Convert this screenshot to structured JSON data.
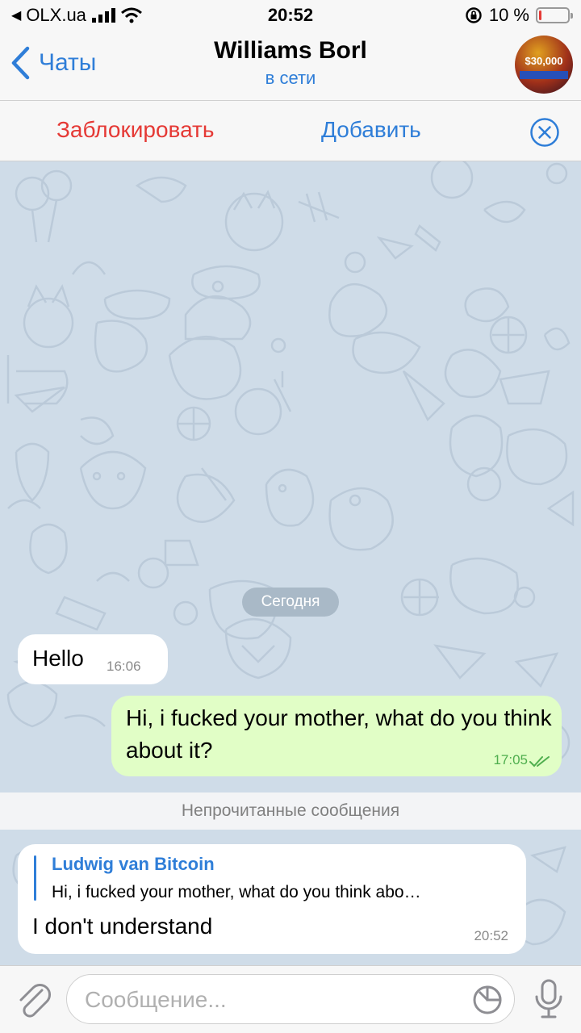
{
  "status_bar": {
    "back_app": "OLX.ua",
    "time": "20:52",
    "battery_text": "10 %",
    "battery_level": 0.1
  },
  "header": {
    "back_label": "Чаты",
    "title": "Williams Borl",
    "subtitle": "в сети"
  },
  "actions": {
    "block_label": "Заблокировать",
    "add_label": "Добавить"
  },
  "chat": {
    "date_separator": "Сегодня",
    "unread_separator": "Непрочитанные сообщения",
    "messages": [
      {
        "direction": "incoming",
        "text": "Hello",
        "time": "16:06"
      },
      {
        "direction": "outgoing",
        "text": "Hi, i fucked your mother, what do you think about it?",
        "time": "17:05",
        "read": true
      },
      {
        "direction": "incoming",
        "reply_to_name": "Ludwig van Bitcoin",
        "reply_to_text": "Hi, i fucked your mother, what do you think abo…",
        "text": "I don't understand",
        "time": "20:52"
      }
    ]
  },
  "input": {
    "placeholder": "Сообщение..."
  },
  "colors": {
    "accent": "#2f7ed8",
    "danger": "#e53935",
    "chat_background": "#cfdce8",
    "outgoing_bubble": "#e1fec6"
  },
  "icons": [
    "back-chevron-icon",
    "signal-icon",
    "wifi-icon",
    "rotation-lock-icon",
    "battery-icon",
    "close-circle-icon",
    "double-check-icon",
    "attach-icon",
    "sticker-icon",
    "microphone-icon"
  ]
}
